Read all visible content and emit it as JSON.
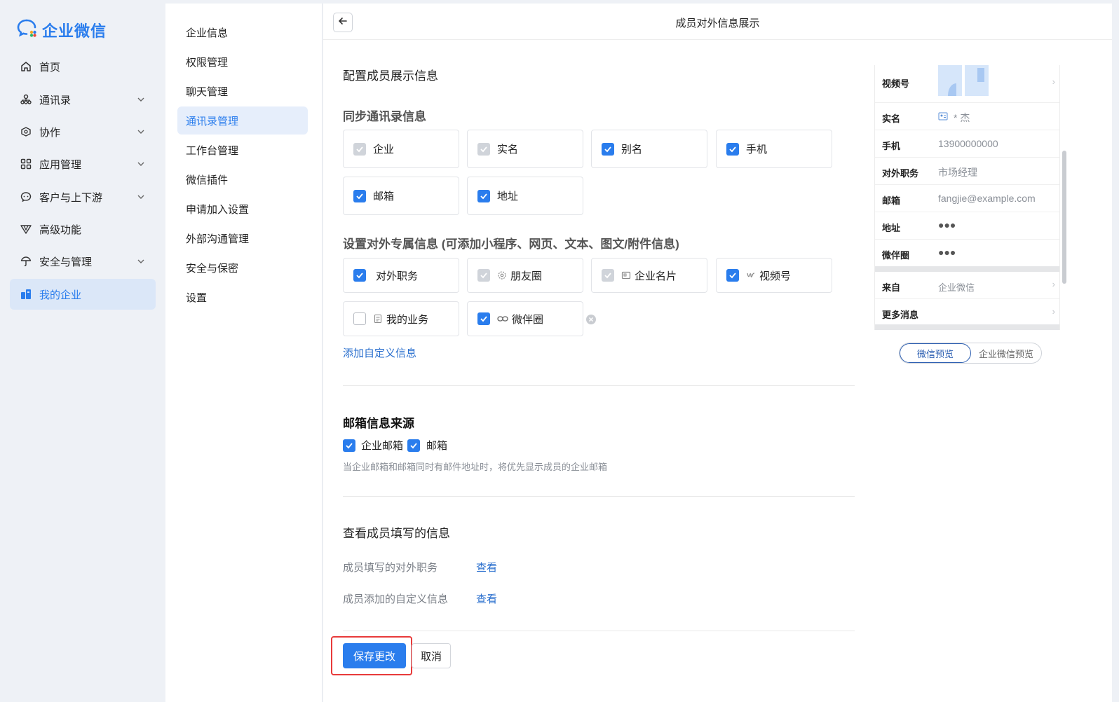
{
  "app": {
    "name": "企业微信"
  },
  "nav": {
    "items": [
      {
        "label": "首页",
        "icon": "home-icon",
        "expandable": false
      },
      {
        "label": "通讯录",
        "icon": "contacts-icon",
        "expandable": true
      },
      {
        "label": "协作",
        "icon": "collab-icon",
        "expandable": true
      },
      {
        "label": "应用管理",
        "icon": "apps-icon",
        "expandable": true
      },
      {
        "label": "客户与上下游",
        "icon": "customer-icon",
        "expandable": true
      },
      {
        "label": "高级功能",
        "icon": "advanced-icon",
        "expandable": false
      },
      {
        "label": "安全与管理",
        "icon": "security-icon",
        "expandable": true
      },
      {
        "label": "我的企业",
        "icon": "company-icon",
        "expandable": false,
        "active": true
      }
    ]
  },
  "submenu": {
    "items": [
      "企业信息",
      "权限管理",
      "聊天管理",
      "通讯录管理",
      "工作台管理",
      "微信插件",
      "申请加入设置",
      "外部沟通管理",
      "安全与保密",
      "设置"
    ],
    "active_index": 3
  },
  "header": {
    "title": "成员对外信息展示"
  },
  "config": {
    "heading": "配置成员展示信息",
    "sync_heading": "同步通讯录信息",
    "sync_items": [
      {
        "label": "企业",
        "state": "disabled"
      },
      {
        "label": "实名",
        "state": "disabled"
      },
      {
        "label": "别名",
        "state": "checked"
      },
      {
        "label": "手机",
        "state": "checked"
      },
      {
        "label": "邮箱",
        "state": "checked"
      },
      {
        "label": "地址",
        "state": "checked"
      }
    ],
    "external_heading": "设置对外专属信息 (可添加小程序、网页、文本、图文/附件信息)",
    "external_items": [
      {
        "label": "对外职务",
        "state": "checked",
        "icon": ""
      },
      {
        "label": "朋友圈",
        "state": "disabled",
        "icon": "moments-icon"
      },
      {
        "label": "企业名片",
        "state": "disabled",
        "icon": "card-icon"
      },
      {
        "label": "视频号",
        "state": "checked",
        "icon": "channels-icon"
      },
      {
        "label": "我的业务",
        "state": "unchecked",
        "icon": "doc-icon"
      },
      {
        "label": "微伴圈",
        "state": "checked",
        "icon": "link-icon"
      }
    ],
    "add_custom": "添加自定义信息"
  },
  "email_source": {
    "heading": "邮箱信息来源",
    "options": [
      {
        "label": "企业邮箱",
        "checked": true
      },
      {
        "label": "邮箱",
        "checked": true
      }
    ],
    "hint": "当企业邮箱和邮箱同时有邮件地址时，将优先显示成员的企业邮箱"
  },
  "member_info": {
    "heading": "查看成员填写的信息",
    "rows": [
      {
        "label": "成员填写的对外职务",
        "action": "查看"
      },
      {
        "label": "成员添加的自定义信息",
        "action": "查看"
      }
    ]
  },
  "actions": {
    "save": "保存更改",
    "cancel": "取消"
  },
  "preview": {
    "rows": [
      {
        "label": "视频号",
        "value": "",
        "chevron": true
      },
      {
        "label": "实名",
        "value": "* 杰",
        "chevron": false
      },
      {
        "label": "手机",
        "value": "13900000000",
        "chevron": false
      },
      {
        "label": "对外职务",
        "value": "市场经理",
        "chevron": false
      },
      {
        "label": "邮箱",
        "value": "fangjie@example.com",
        "chevron": false
      },
      {
        "label": "地址",
        "value": "●●●",
        "chevron": false
      },
      {
        "label": "微伴圈",
        "value": "●●●",
        "chevron": false
      },
      {
        "label": "来自",
        "value": "企业微信",
        "chevron": true
      },
      {
        "label": "更多消息",
        "value": "",
        "chevron": true
      }
    ],
    "toggle": [
      "微信预览",
      "企业微信预览"
    ],
    "toggle_selected": 0
  },
  "colors": {
    "accent": "#2a7ded",
    "highlight": "#e83a3a",
    "link": "#2a6fce"
  }
}
